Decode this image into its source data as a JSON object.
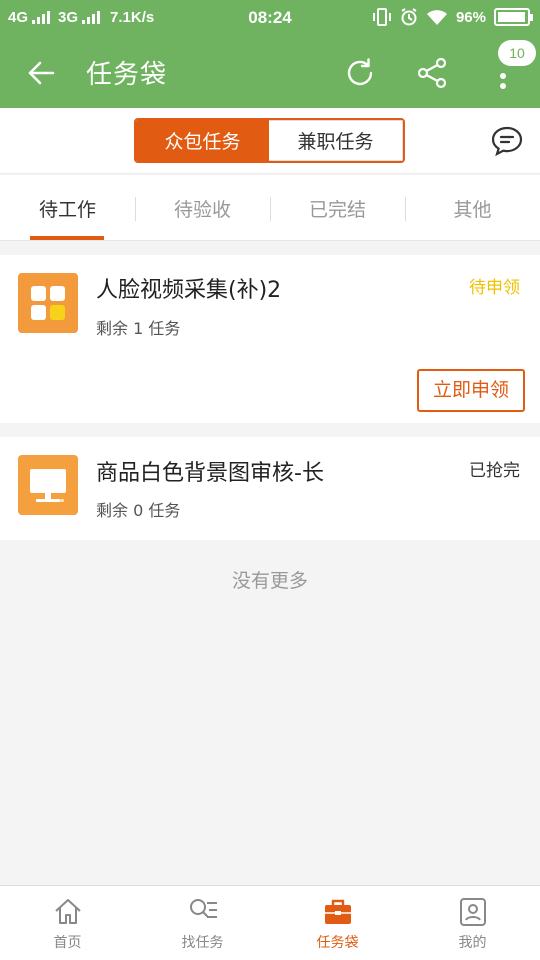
{
  "status_bar": {
    "net1": "4G",
    "net2": "3G",
    "speed": "7.1K/s",
    "time": "08:24",
    "battery": "96%",
    "battery_level": 0.96
  },
  "app_bar": {
    "title": "任务袋",
    "badge_count": "10",
    "icons": [
      "back-arrow-icon",
      "refresh-icon",
      "share-icon",
      "more-vert-icon"
    ]
  },
  "segment": {
    "options": [
      "众包任务",
      "兼职任务"
    ],
    "selected": "众包任务"
  },
  "tabs": [
    "待工作",
    "待验收",
    "已完结",
    "其他"
  ],
  "active_tab": "待工作",
  "tasks": [
    {
      "title": "人脸视频采集(补)2",
      "remain": "剩余 1 任务",
      "status": "待申领",
      "action": "立即申领",
      "icon": "grid-apps-icon"
    },
    {
      "title": "商品白色背景图审核-长",
      "remain": "剩余 0 任务",
      "status": "已抢完",
      "icon": "monitor-icon"
    }
  ],
  "footer_text": "没有更多",
  "bottom_nav": [
    {
      "label": "首页",
      "icon": "home-icon"
    },
    {
      "label": "找任务",
      "icon": "search-list-icon"
    },
    {
      "label": "任务袋",
      "icon": "briefcase-icon"
    },
    {
      "label": "我的",
      "icon": "profile-icon"
    }
  ],
  "colors": {
    "primary_green": "#6fb25f",
    "accent_orange": "#e25b12",
    "pending_yellow": "#f2c200"
  }
}
